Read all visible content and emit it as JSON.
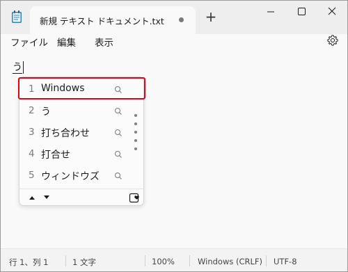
{
  "tab": {
    "title": "新規 テキスト ドキュメント.txt",
    "new_tab_symbol": "+"
  },
  "window_controls": [
    "minimize-icon",
    "maximize-icon",
    "close-icon"
  ],
  "menu": {
    "file": "ファイル",
    "edit": "編集",
    "view": "表示"
  },
  "editor": {
    "text": "う"
  },
  "ime": {
    "candidates": [
      {
        "num": "1",
        "text": "Windows"
      },
      {
        "num": "2",
        "text": "う"
      },
      {
        "num": "3",
        "text": "打ち合わせ"
      },
      {
        "num": "4",
        "text": "打合せ"
      },
      {
        "num": "5",
        "text": "ウィンドウズ"
      }
    ],
    "selected_index": 0
  },
  "status": {
    "position": "行 1、列 1",
    "chars": "1 文字",
    "zoom": "100%",
    "line_ending": "Windows (CRLF)",
    "encoding": "UTF-8"
  },
  "colors": {
    "highlight": "#e60012",
    "titlebar": "#eeeeee",
    "background": "#f9f9f9"
  }
}
